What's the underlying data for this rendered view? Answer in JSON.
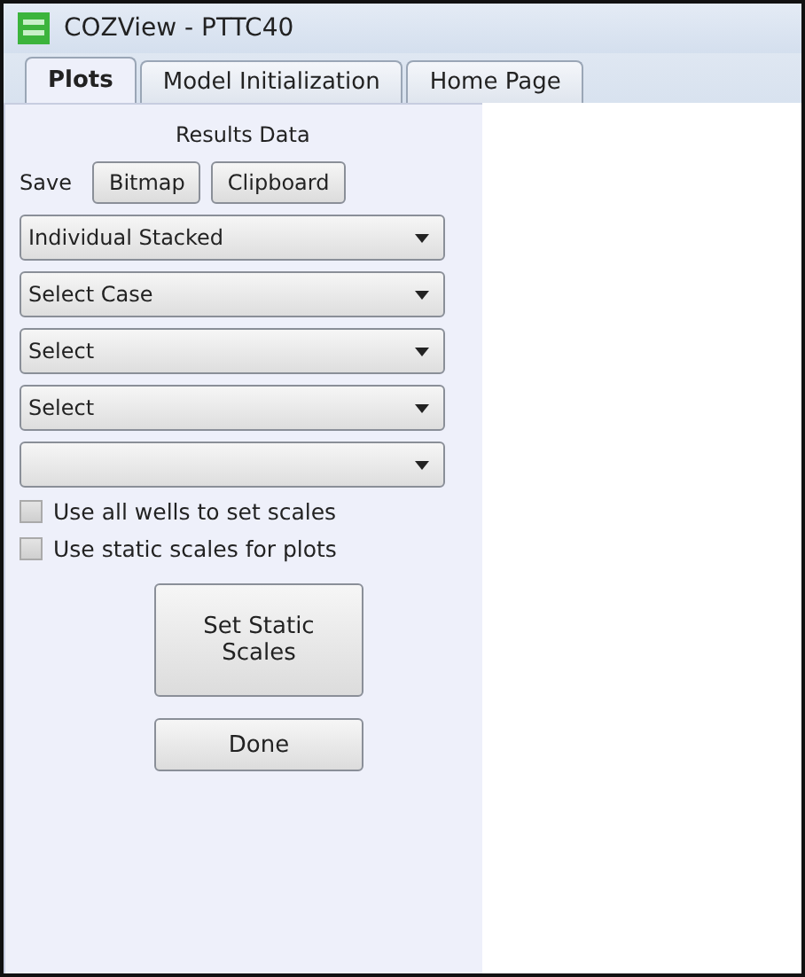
{
  "window": {
    "title": "COZView - PTTC40"
  },
  "tabs": [
    {
      "label": "Plots",
      "selected": true
    },
    {
      "label": "Model Initialization",
      "selected": false
    },
    {
      "label": "Home Page",
      "selected": false
    }
  ],
  "panel": {
    "heading": "Results Data",
    "save_label": "Save",
    "save_buttons": [
      "Bitmap",
      "Clipboard"
    ],
    "dropdowns": [
      {
        "kind": "filled",
        "value": "Individual Stacked"
      },
      {
        "kind": "filled",
        "value": "Select Case"
      },
      {
        "kind": "filled",
        "value": "Select"
      },
      {
        "kind": "filled",
        "value": "Select"
      },
      {
        "kind": "blank"
      }
    ],
    "checkboxes": [
      {
        "label": "Use all wells to set scales",
        "checked": false
      },
      {
        "label": "Use static scales for plots",
        "checked": false
      }
    ],
    "buttons": [
      {
        "label": "Set Static Scales",
        "kind": "tall"
      },
      {
        "label": "Done",
        "kind": "short"
      }
    ]
  }
}
